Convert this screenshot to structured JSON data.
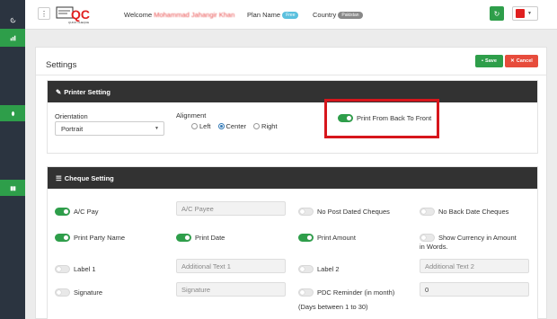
{
  "topbar": {
    "menu_icon": "vertical-dots-icon",
    "logo_text": "QC",
    "logo_sub": "QUICK CHEQUE",
    "welcome_label": "Welcome",
    "welcome_name": "Mohammad Jahangir Khan",
    "plan_label": "Plan Name",
    "plan_value": "Free",
    "country_label": "Country",
    "country_value": "Pakistan",
    "refresh_icon": "refresh-icon",
    "user_icon": "flag-icon"
  },
  "sidebar": {
    "items": [
      {
        "icon": "dashboard-icon"
      },
      {
        "icon": "chart-icon"
      },
      {
        "icon": "leaf-icon"
      },
      {
        "icon": "book-icon"
      }
    ]
  },
  "settings": {
    "title": "Settings",
    "save_label": "Save",
    "cancel_label": "Cancel"
  },
  "printer": {
    "title": "Printer Setting",
    "orientation_label": "Orientation",
    "orientation_value": "Portrait",
    "alignment_label": "Alignment",
    "alignment_options": [
      "Left",
      "Center",
      "Right"
    ],
    "alignment_selected": "Center",
    "print_back_to_front_label": "Print From Back To Front",
    "print_back_to_front_on": true
  },
  "cheque": {
    "title": "Cheque Setting",
    "ac_pay_label": "A/C Pay",
    "ac_pay_placeholder": "A/C Payee",
    "no_post_dated_label": "No Post Dated Cheques",
    "no_back_date_label": "No Back Date Cheques",
    "print_party_label": "Print Party Name",
    "print_date_label": "Print Date",
    "print_amount_label": "Print Amount",
    "show_currency_label": "Show Currency in Amount in Words.",
    "label1_label": "Label 1",
    "label1_placeholder": "Additional Text 1",
    "label2_label": "Label 2",
    "label2_placeholder": "Additional Text 2",
    "signature_label": "Signature",
    "signature_placeholder": "Signature",
    "pdc_label": "PDC Reminder (in month)",
    "pdc_value": "0",
    "pdc_hint": "(Days between 1 to 30)"
  },
  "colors": {
    "sidebar": "#2b3440",
    "accent_green": "#2e9e4a",
    "danger": "#e74c3c",
    "highlight": "#d7161c",
    "section_header": "#323232"
  }
}
